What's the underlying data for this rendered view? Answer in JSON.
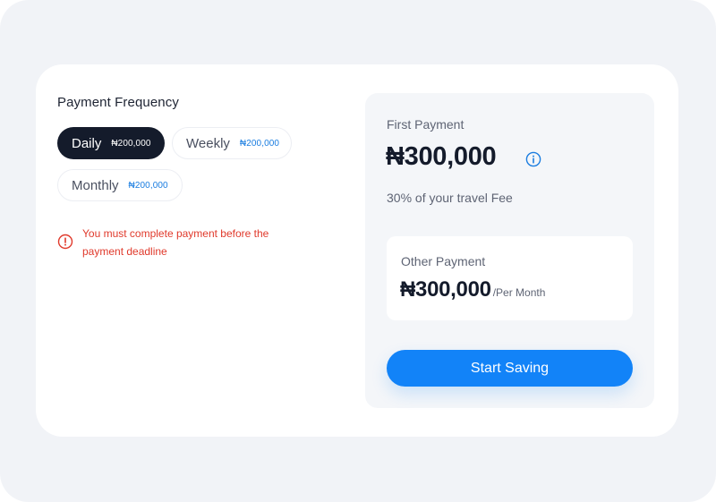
{
  "payment_frequency": {
    "title": "Payment Frequency",
    "options": [
      {
        "label": "Daily",
        "amount": "₦200,000",
        "selected": true
      },
      {
        "label": "Weekly",
        "amount": "₦200,000",
        "selected": false
      },
      {
        "label": "Monthly",
        "amount": "₦200,000",
        "selected": false
      }
    ],
    "warning": "You must complete payment before the payment deadline"
  },
  "summary": {
    "first_payment_label": "First Payment",
    "first_payment_amount": "₦300,000",
    "first_payment_note": "30% of your travel Fee",
    "other_payment_label": "Other Payment",
    "other_payment_amount": "₦300,000",
    "other_payment_period": "/Per Month",
    "cta_label": "Start Saving"
  },
  "colors": {
    "accent": "#1283f8",
    "selected_pill": "#141b2b",
    "warning": "#e0392b",
    "info_icon": "#1a7de0"
  },
  "icons": {
    "warning": "alert-circle-icon",
    "info": "info-circle-icon"
  }
}
